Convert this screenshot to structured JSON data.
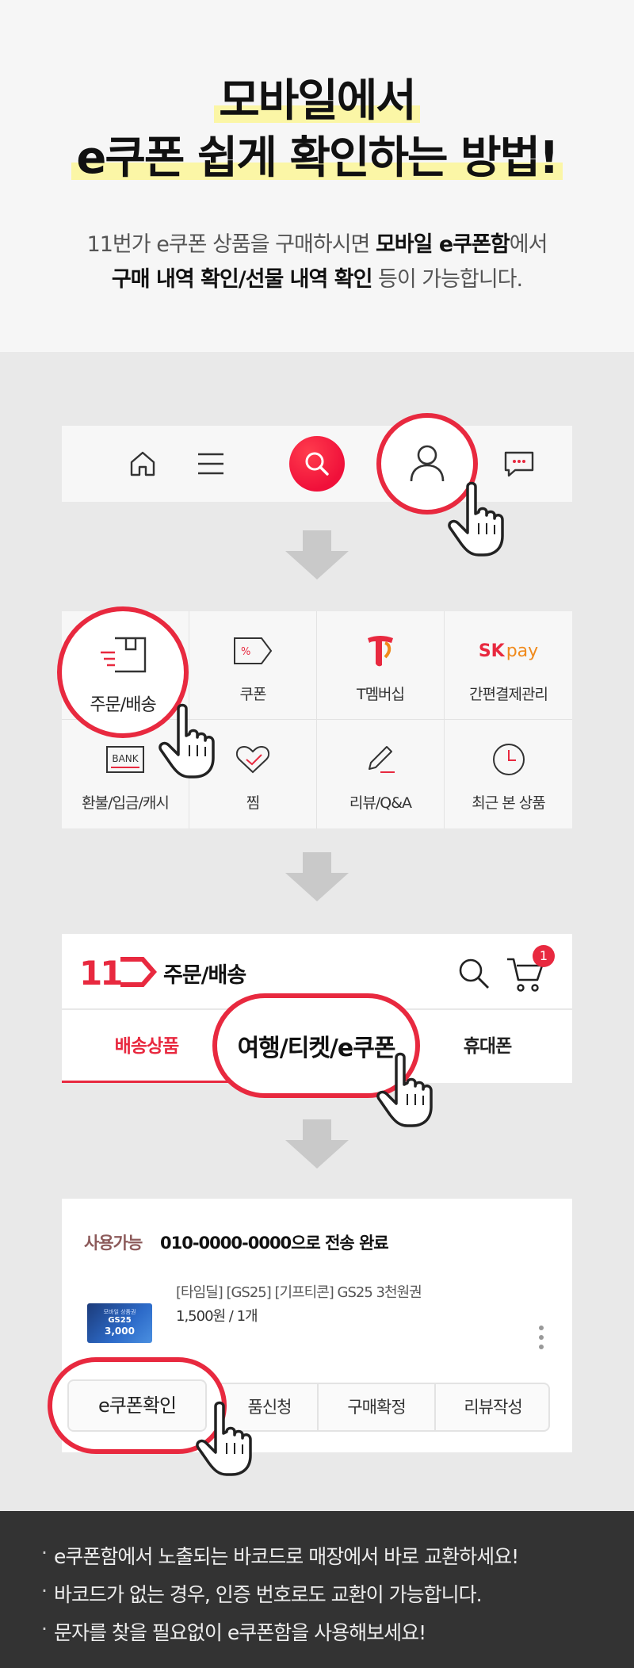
{
  "header": {
    "title_line1": "모바일에서",
    "title_line2": "e쿠폰 쉽게 확인하는 방법!",
    "sub_line1_a": "11번가 e쿠폰 상품을 구매하시면 ",
    "sub_line1_b": "모바일 e쿠폰함",
    "sub_line1_c": "에서",
    "sub_line2_a": "구매 내역 확인/선물 내역 확인",
    "sub_line2_b": " 등이 가능합니다."
  },
  "menu_grid": {
    "items": [
      {
        "label": "주문/배송",
        "icon": "box-icon"
      },
      {
        "label": "쿠폰",
        "icon": "coupon-icon"
      },
      {
        "label": "T멤버십",
        "icon": "t-logo-icon"
      },
      {
        "label": "간편결제관리",
        "icon": "sk-pay-logo"
      },
      {
        "label": "환불/입금/캐시",
        "icon": "bank-icon"
      },
      {
        "label": "찜",
        "icon": "heart-icon"
      },
      {
        "label": "리뷰/Q&A",
        "icon": "pencil-icon"
      },
      {
        "label": "최근 본 상품",
        "icon": "clock-icon"
      }
    ],
    "bank_text": "BANK",
    "skpay_sk": "SK",
    "skpay_pay": "pay"
  },
  "order_screen": {
    "logo": "11",
    "title": "주문/배송",
    "cart_count": "1",
    "tabs": [
      "배송상품",
      "여행/티켓/e쿠폰",
      "휴대폰"
    ]
  },
  "coupon_card": {
    "status": "사용가능",
    "sent_text": "010-0000-0000으로 전송 완료",
    "product_name": "[타임딜] [GS25] [기프티콘] GS25 3천원권",
    "price": "1,500원 / 1개",
    "thumb_small": "모바일 상품권",
    "thumb_brand": "GS25",
    "thumb_amount": "3,000",
    "buttons": [
      "e쿠폰확인",
      "품신청",
      "구매확정",
      "리뷰작성"
    ]
  },
  "footer": {
    "notes": [
      "e쿠폰함에서 노출되는 바코드로 매장에서 바로 교환하세요!",
      "바코드가 없는 경우, 인증 번호로도 교환이 가능합니다.",
      "문자를 찾을 필요없이 e쿠폰함을 사용해보세요!"
    ]
  },
  "colors": {
    "accent": "#e8293f",
    "highlight": "#fbf6a6",
    "footer_bg": "#333333"
  }
}
